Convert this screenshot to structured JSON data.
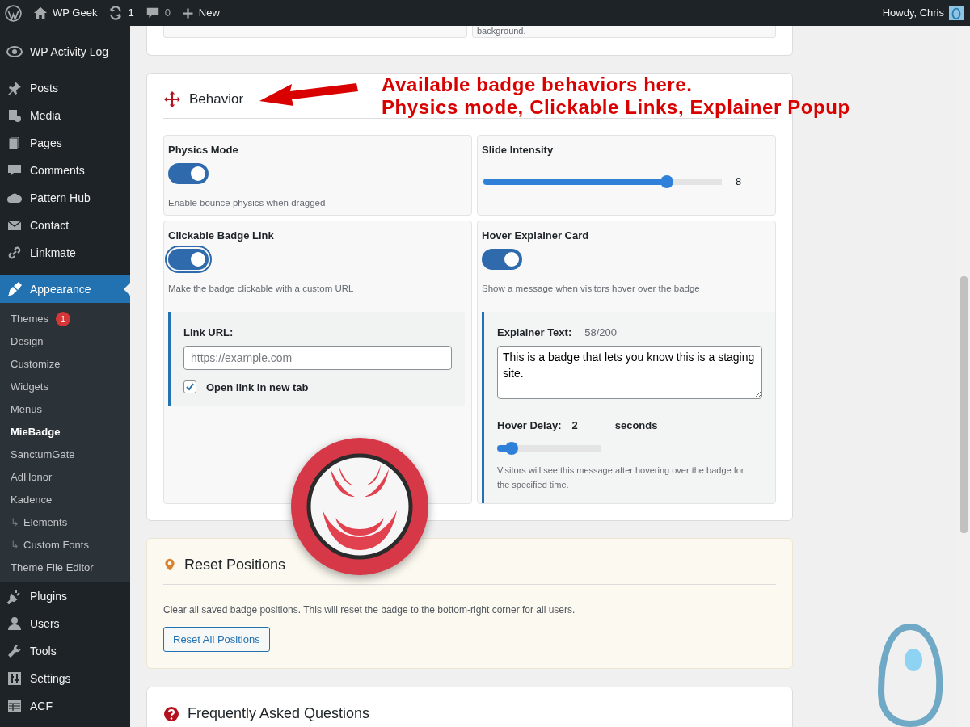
{
  "admin_bar": {
    "site": "WP Geek",
    "updates": "1",
    "comments": "0",
    "new": "New",
    "greeting": "Howdy, Chris"
  },
  "sidebar": {
    "groups": [
      [
        {
          "label": "WP Activity Log",
          "selected": false
        }
      ],
      [
        {
          "label": "Posts",
          "selected": false
        },
        {
          "label": "Media",
          "selected": false
        },
        {
          "label": "Pages",
          "selected": false
        },
        {
          "label": "Comments",
          "selected": false
        },
        {
          "label": "Pattern Hub",
          "selected": false
        },
        {
          "label": "Contact",
          "selected": false
        },
        {
          "label": "Linkmate",
          "selected": false
        }
      ],
      [
        {
          "label": "Appearance",
          "selected": true,
          "submenu": [
            {
              "label": "Themes",
              "badge": "1",
              "current": false
            },
            {
              "label": "Design",
              "current": false
            },
            {
              "label": "Customize",
              "current": false
            },
            {
              "label": "Widgets",
              "current": false
            },
            {
              "label": "Menus",
              "current": false
            },
            {
              "label": "MieBadge",
              "current": true
            },
            {
              "label": "SanctumGate",
              "current": false
            },
            {
              "label": "AdHonor",
              "current": false
            },
            {
              "label": "Kadence",
              "current": false,
              "children": [
                {
                  "marker": "↳",
                  "label": "Elements",
                  "current": false
                },
                {
                  "marker": "↳",
                  "label": "Custom Fonts",
                  "current": false
                }
              ]
            },
            {
              "label": "Theme File Editor",
              "current": false
            }
          ]
        },
        {
          "label": "Plugins",
          "selected": false
        },
        {
          "label": "Users",
          "selected": false
        },
        {
          "label": "Tools",
          "selected": false
        },
        {
          "label": "Settings",
          "selected": false
        },
        {
          "label": "ACF",
          "selected": false
        }
      ]
    ]
  },
  "top_card": {
    "note": "background."
  },
  "behavior": {
    "title": "Behavior",
    "annotation": {
      "lines": [
        "Available badge behaviors here.",
        "Physics mode, Clickable Links, Explainer Popup"
      ]
    },
    "settings": [
      {
        "kind": "toggle",
        "label": "Physics Mode",
        "on": true,
        "focused": false,
        "help": "Enable bounce physics when dragged"
      },
      {
        "kind": "slider",
        "label": "Slide Intensity",
        "level": 0.77,
        "reading": "8"
      },
      {
        "kind": "toggle",
        "label": "Clickable Badge Link",
        "on": true,
        "focused": true,
        "help": "Make the badge clickable with a custom URL",
        "panel": {
          "kind": "link",
          "url_label": "Link URL:",
          "placeholder": "https://example.com",
          "new_tab": {
            "label": "Open link in new tab",
            "checked": true
          }
        }
      },
      {
        "kind": "toggle",
        "label": "Hover Explainer Card",
        "on": true,
        "focused": false,
        "help": "Show a message when visitors hover over the badge",
        "panel": {
          "kind": "explainer",
          "text_label": "Explainer Text:",
          "counter": "58/200",
          "text": "This is a badge that lets you know this is a staging site.",
          "delay_label": "Hover Delay:",
          "delay_value": "2",
          "delay_unit": "seconds",
          "level": 0.14,
          "note": "Visitors will see this message after hovering over the badge for the specified time."
        }
      }
    ]
  },
  "reset": {
    "title": "Reset Positions",
    "text": "Clear all saved badge positions. This will reset the badge to the bottom-right corner for all users.",
    "button": "Reset All Positions"
  },
  "faq": {
    "title": "Frequently Asked Questions"
  }
}
